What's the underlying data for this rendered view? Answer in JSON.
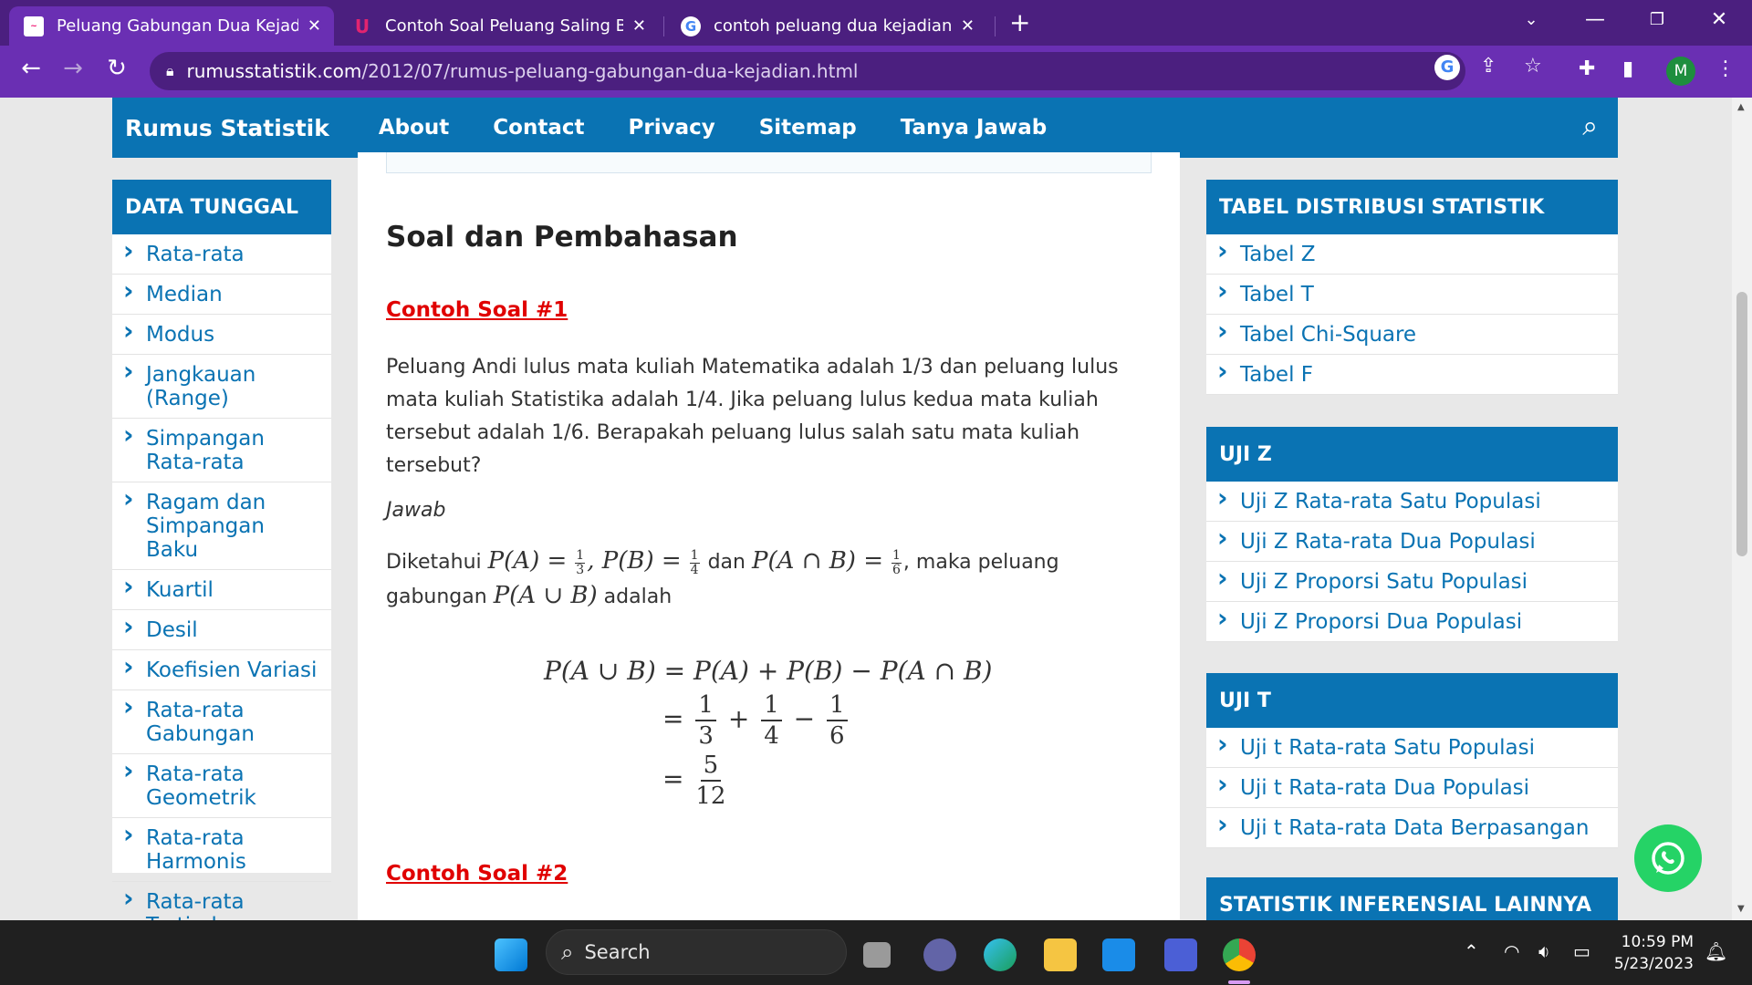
{
  "browser": {
    "tabs": [
      {
        "title": "Peluang Gabungan Dua Kejadian",
        "favicon": "rumusstatistik-favicon",
        "active": true
      },
      {
        "title": "Contoh Soal Peluang Saling Beba",
        "favicon": "ukg-favicon",
        "active": false
      },
      {
        "title": "contoh peluang dua kejadian tid",
        "favicon": "google-favicon",
        "active": false
      }
    ],
    "url_host": "rumusstatistik.com",
    "url_path": "/2012/07/rumus-peluang-gabungan-dua-kejadian.html",
    "profile_initial": "M",
    "accent": "#6a2fb3",
    "tab_strip_color": "#4b1f7f"
  },
  "site": {
    "brand": "Rumus Statistik",
    "nav": [
      "About",
      "Contact",
      "Privacy",
      "Sitemap",
      "Tanya Jawab"
    ],
    "accent": "#0a73b3"
  },
  "left_sidebar": {
    "title": "DATA TUNGGAL",
    "items": [
      "Rata-rata",
      "Median",
      "Modus",
      "Jangkauan (Range)",
      "Simpangan Rata-rata",
      "Ragam dan Simpangan Baku",
      "Kuartil",
      "Desil",
      "Koefisien Variasi",
      "Rata-rata Gabungan",
      "Rata-rata Geometrik",
      "Rata-rata Harmonis",
      "Rata-rata Tertimbang"
    ]
  },
  "right_sidebar": [
    {
      "title": "TABEL DISTRIBUSI STATISTIK",
      "items": [
        "Tabel Z",
        "Tabel T",
        "Tabel Chi-Square",
        "Tabel F"
      ]
    },
    {
      "title": "UJI Z",
      "items": [
        "Uji Z Rata-rata Satu Populasi",
        "Uji Z Rata-rata Dua Populasi",
        "Uji Z Proporsi Satu Populasi",
        "Uji Z Proporsi Dua Populasi"
      ]
    },
    {
      "title": "UJI T",
      "items": [
        "Uji t Rata-rata Satu Populasi",
        "Uji t Rata-rata Dua Populasi",
        "Uji t Rata-rata Data Berpasangan"
      ]
    },
    {
      "title": "STATISTIK INFERENSIAL LAINNYA",
      "items": []
    }
  ],
  "article": {
    "heading": "Soal dan Pembahasan",
    "example1_label": "Contoh Soal #1",
    "question": "Peluang Andi lulus mata kuliah Matematika adalah 1/3 dan peluang lulus mata kuliah Statistika adalah 1/4. Jika peluang lulus kedua mata kuliah tersebut adalah 1/6. Berapakah peluang lulus salah satu mata kuliah tersebut?",
    "answer_label": "Jawab",
    "given_prefix": "Diketahui",
    "given_pa": "P(A) =",
    "given_pb": ", P(B) =",
    "given_and": "dan",
    "given_pab": "P(A ∩ B) =",
    "given_suffix": ", maka peluang",
    "given_line2_prefix": "gabungan",
    "given_union": "P(A ∪ B)",
    "given_line2_suffix": "adalah",
    "frac_1_3": [
      "1",
      "3"
    ],
    "frac_1_4": [
      "1",
      "4"
    ],
    "frac_1_6": [
      "1",
      "6"
    ],
    "frac_5_12": [
      "5",
      "12"
    ],
    "eq_line1": "P(A ∪ B) = P(A) + P(B) − P(A ∩ B)",
    "eq_equals": "=",
    "eq_plus": "+",
    "eq_minus": "−",
    "example2_label": "Contoh Soal #2"
  },
  "taskbar": {
    "search_placeholder": "Search",
    "time": "10:59 PM",
    "date": "5/23/2023"
  }
}
